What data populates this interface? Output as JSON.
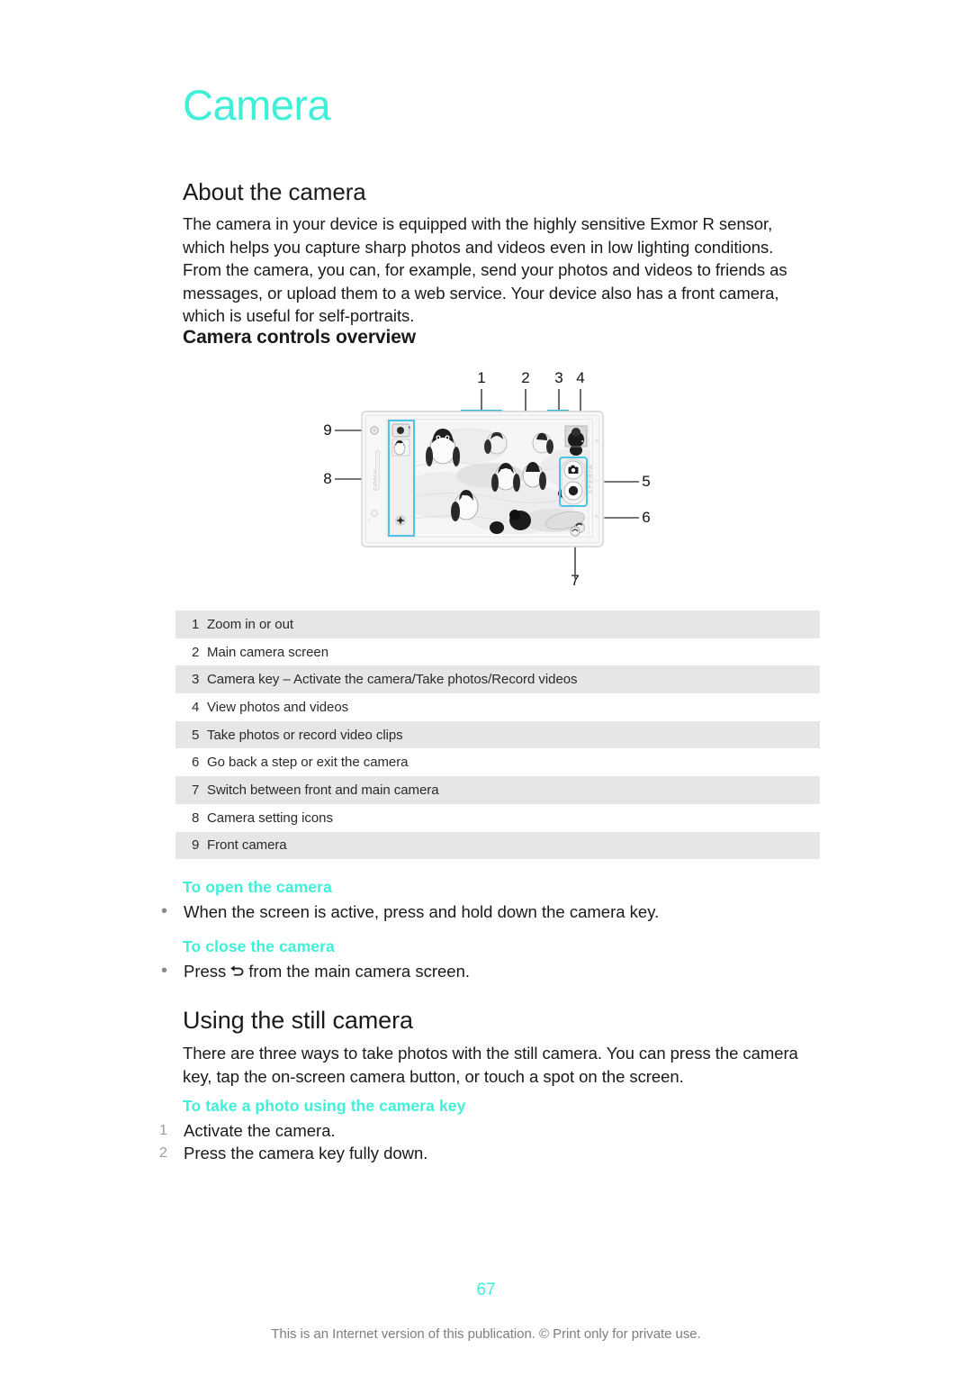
{
  "document": {
    "chapter_title": "Camera",
    "page_number": "67",
    "footer_note": "This is an Internet version of this publication. © Print only for private use."
  },
  "sections": {
    "about": {
      "heading": "About the camera",
      "paragraph": "The camera in your device is equipped with the highly sensitive Exmor R sensor, which helps you capture sharp photos and videos even in low lighting conditions. From the camera, you can, for example, send your photos and videos to friends as messages, or upload them to a web service. Your device also has a front camera, which is useful for self-portraits."
    },
    "controls_overview": {
      "heading": "Camera controls overview"
    },
    "still_camera": {
      "heading": "Using the still camera",
      "paragraph": "There are three ways to take photos with the still camera. You can press the camera key, tap the on-screen camera button, or touch a spot on the screen."
    }
  },
  "figure": {
    "name": "camera-controls-diagram",
    "device_brand": "SONY",
    "device_model": "XPERIA",
    "callouts": [
      "1",
      "2",
      "3",
      "4",
      "5",
      "6",
      "7",
      "8",
      "9"
    ],
    "highlight_color": "#4ec3e8",
    "screen_description": "Camera viewfinder showing penguins on snow"
  },
  "reference_table": {
    "rows": [
      {
        "num": "1",
        "text": "Zoom in or out"
      },
      {
        "num": "2",
        "text": "Main camera screen"
      },
      {
        "num": "3",
        "text": "Camera key – Activate the camera/Take photos/Record videos"
      },
      {
        "num": "4",
        "text": "View photos and videos"
      },
      {
        "num": "5",
        "text": "Take photos or record video clips"
      },
      {
        "num": "6",
        "text": "Go back a step or exit the camera"
      },
      {
        "num": "7",
        "text": "Switch between front and main camera"
      },
      {
        "num": "8",
        "text": "Camera setting icons"
      },
      {
        "num": "9",
        "text": "Front camera"
      }
    ]
  },
  "tasks": {
    "open_camera": {
      "heading": "To open the camera",
      "bullet": "When the screen is active, press and hold down the camera key.",
      "bullet_marker": "•"
    },
    "close_camera": {
      "heading": "To close the camera",
      "bullet_marker": "•",
      "bullet_prefix": "Press",
      "bullet_icon": "back-arrow-icon",
      "bullet_suffix": "from the main camera screen."
    },
    "take_photo": {
      "heading": "To take a photo using the camera key",
      "steps": [
        {
          "num": "1",
          "text": "Activate the camera."
        },
        {
          "num": "2",
          "text": "Press the camera key fully down."
        }
      ]
    }
  },
  "colors": {
    "accent_mint": "#3ff0d8",
    "table_shade": "#e6e6e6",
    "body_text": "#1a1a1a",
    "footer_text": "#7d7d7d"
  }
}
